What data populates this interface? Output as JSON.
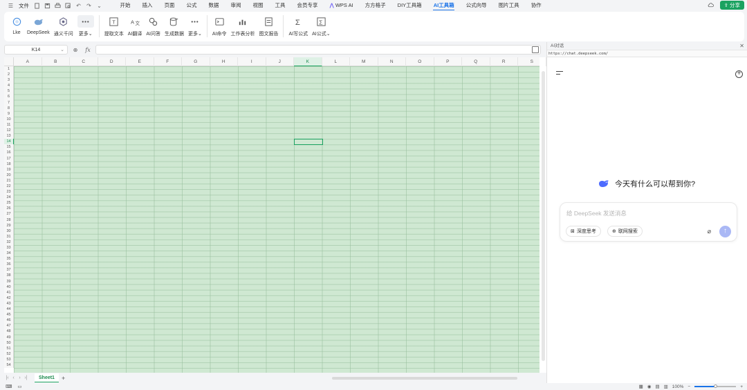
{
  "menu": {
    "file_label": "文件"
  },
  "tabs": [
    "开始",
    "插入",
    "页面",
    "公式",
    "数据",
    "审阅",
    "视图",
    "工具",
    "会员专享",
    "WPS AI",
    "方方格子",
    "DIY工具箱",
    "AI工具箱",
    "公式向导",
    "图片工具",
    "协作"
  ],
  "active_tab": "AI工具箱",
  "share_label": "分享",
  "ribbon": {
    "items": [
      {
        "label": "Lke",
        "icon": "lke-icon"
      },
      {
        "label": "DeepSeek",
        "icon": "deepseek-whale-icon"
      },
      {
        "label": "通义千问",
        "icon": "tongyi-icon"
      },
      {
        "label": "更多",
        "icon": "more-dots-icon",
        "dropdown": true
      },
      {
        "label": "提取文本",
        "icon": "extract-text-icon"
      },
      {
        "label": "AI翻译",
        "icon": "translate-icon"
      },
      {
        "label": "AI问答",
        "icon": "qa-icon"
      },
      {
        "label": "生成数据",
        "icon": "database-icon"
      },
      {
        "label": "更多",
        "icon": "more-dots-icon",
        "dropdown": true
      },
      {
        "label": "AI命令",
        "icon": "terminal-icon"
      },
      {
        "label": "工作表分析",
        "icon": "chart-analysis-icon"
      },
      {
        "label": "图文报告",
        "icon": "report-icon"
      },
      {
        "label": "AI写公式",
        "icon": "sigma-icon"
      },
      {
        "label": "AI公式",
        "icon": "sigma-box-icon",
        "dropdown": true
      }
    ]
  },
  "formula_bar": {
    "name_box": "K14",
    "fx": "fx",
    "formula": ""
  },
  "grid": {
    "columns": [
      "A",
      "B",
      "C",
      "D",
      "E",
      "F",
      "G",
      "H",
      "I",
      "J",
      "K",
      "L",
      "M",
      "N",
      "O",
      "P",
      "Q",
      "R",
      "S"
    ],
    "rows": 54,
    "selected_cell": "K14",
    "selected_col": "K",
    "selected_row": 14,
    "fill_color": "#cfe8d2"
  },
  "sheets": [
    {
      "name": "Sheet1",
      "active": true
    }
  ],
  "status": {
    "zoom": "100%"
  },
  "ai_panel": {
    "title": "AI对话",
    "url": "https://chat.deepseek.com/",
    "greeting": "今天有什么可以帮到你?",
    "input_placeholder": "给 DeepSeek 发送消息",
    "chip_deep_think": "深度思考",
    "chip_web_search": "联网搜索"
  },
  "colors": {
    "accent": "#1aa260",
    "tab_active": "#1a73e8",
    "send_button": "#aab8f5"
  }
}
